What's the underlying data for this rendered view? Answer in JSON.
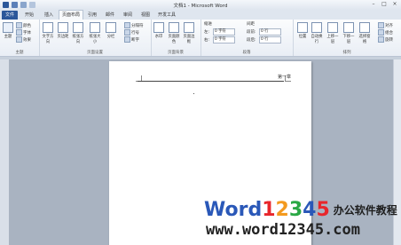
{
  "window": {
    "title": "文档1 - Microsoft Word"
  },
  "tabs": [
    "文件",
    "开始",
    "插入",
    "页面布局",
    "引用",
    "邮件",
    "审阅",
    "视图",
    "开发工具"
  ],
  "ribbon": {
    "group_theme": {
      "label": "主题",
      "button": "主题",
      "items": [
        "颜色",
        "字体",
        "效果"
      ]
    },
    "group_page_setup": {
      "label": "页面设置",
      "buttons": [
        "文字方向",
        "页边距",
        "纸张方向",
        "纸张大小",
        "分栏"
      ],
      "items": [
        "分隔符",
        "行号",
        "断字"
      ]
    },
    "group_page_bg": {
      "label": "页面背景",
      "buttons": [
        "水印",
        "页面颜色",
        "页面边框"
      ]
    },
    "group_paragraph": {
      "label": "段落",
      "indent_title": "缩进",
      "spacing_title": "间距",
      "left_label": "左:",
      "right_label": "右:",
      "before_label": "段前:",
      "after_label": "段后:",
      "indent_left": "0 字符",
      "indent_right": "0 字符",
      "spacing_before": "0 行",
      "spacing_after": "0 行"
    },
    "group_arrange": {
      "label": "排列",
      "buttons": [
        "位置",
        "自动换行",
        "上移一层",
        "下移一层",
        "选择窗格"
      ],
      "items": [
        "对齐",
        "组合",
        "旋转"
      ]
    }
  },
  "document": {
    "header_text": "第一章"
  },
  "watermark": {
    "word": "Word",
    "digits": [
      "1",
      "2",
      "3",
      "4",
      "5"
    ],
    "chinese": "办公软件教程",
    "url": "www.word12345.com"
  },
  "colors": {
    "file_tab": "#2b579a",
    "digit_colors": [
      "#e8262b",
      "#f39a1f",
      "#2aa845",
      "#2a58b8",
      "#e8262b"
    ]
  }
}
